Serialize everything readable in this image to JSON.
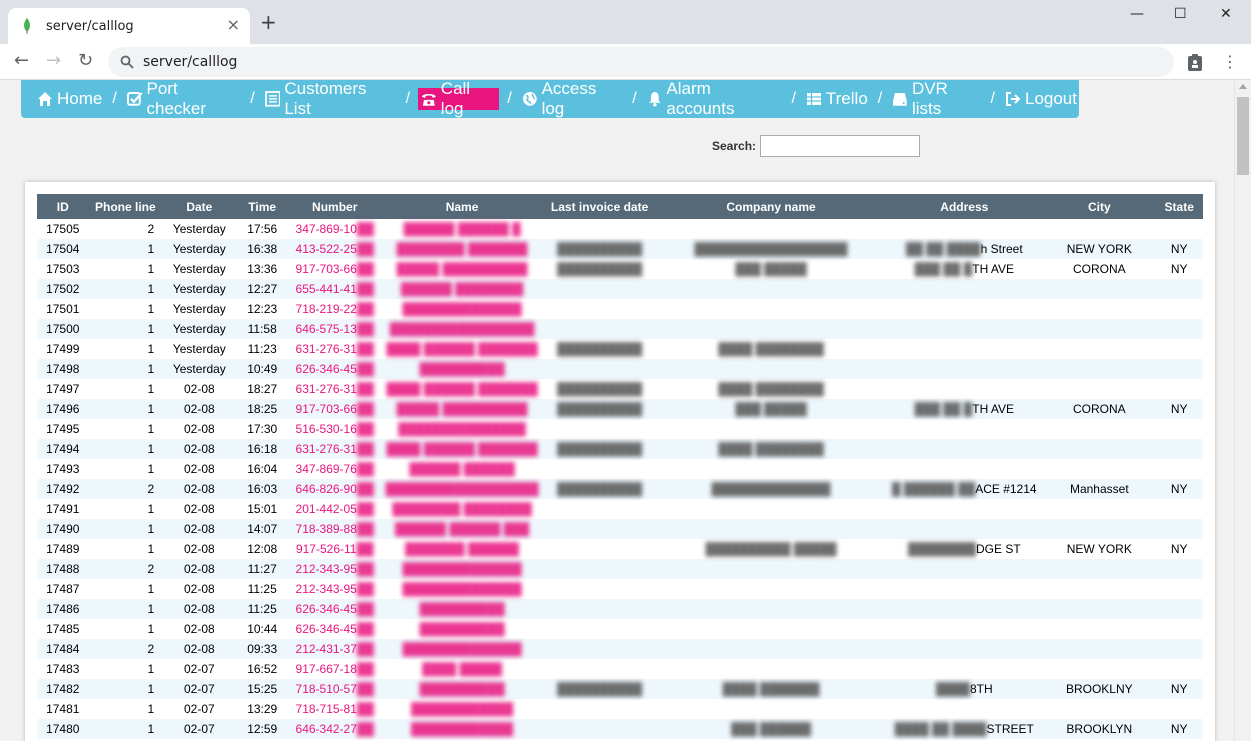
{
  "browser": {
    "tab_title": "server/calllog",
    "url": "server/calllog",
    "new_tab": "+",
    "close_tab": "×",
    "window_minimize": "—",
    "window_maximize": "☐",
    "window_close": "✕"
  },
  "nav": {
    "items": [
      {
        "label": "Home",
        "icon": "home-icon"
      },
      {
        "label": "Port checker",
        "icon": "check-square-icon"
      },
      {
        "label": "Customers List",
        "icon": "list-icon"
      },
      {
        "label": "Call log",
        "icon": "phone-icon",
        "active": true
      },
      {
        "label": "Access log",
        "icon": "globe-icon"
      },
      {
        "label": "Alarm accounts",
        "icon": "bell-icon"
      },
      {
        "label": "Trello",
        "icon": "table-icon"
      },
      {
        "label": "DVR lists",
        "icon": "hdd-icon"
      },
      {
        "label": "Logout",
        "icon": "logout-icon"
      }
    ],
    "separator": "/",
    "active_color": "#e8157f",
    "bar_color": "#5bc0de"
  },
  "search": {
    "label": "Search:",
    "value": ""
  },
  "table": {
    "header_color": "#566978",
    "columns": [
      "ID",
      "Phone line",
      "Date",
      "Time",
      "Number",
      "Name",
      "Last invoice date",
      "Company name",
      "Address",
      "City",
      "State"
    ],
    "rows": [
      {
        "id": "17505",
        "line": "2",
        "date": "Yesterday",
        "time": "17:56",
        "number": "347-869-10",
        "name": "██████ ██████ █",
        "inv": "",
        "comp": "",
        "addr": "",
        "city": "",
        "state": ""
      },
      {
        "id": "17504",
        "line": "1",
        "date": "Yesterday",
        "time": "16:38",
        "number": "413-522-25",
        "name": "████████ ███████",
        "inv": "██████████",
        "comp": "██████████████████",
        "addr": "██ ██ ████h Street",
        "city": "NEW YORK",
        "state": "NY"
      },
      {
        "id": "17503",
        "line": "1",
        "date": "Yesterday",
        "time": "13:36",
        "number": "917-703-66",
        "name": "█████ ██████████",
        "inv": "██████████",
        "comp": "███ █████",
        "addr": "███ ██ █TH AVE",
        "city": "CORONA",
        "state": "NY"
      },
      {
        "id": "17502",
        "line": "1",
        "date": "Yesterday",
        "time": "12:27",
        "number": "655-441-41",
        "name": "██████ ████████",
        "inv": "",
        "comp": "",
        "addr": "",
        "city": "",
        "state": ""
      },
      {
        "id": "17501",
        "line": "1",
        "date": "Yesterday",
        "time": "12:23",
        "number": "718-219-22",
        "name": "██████████████",
        "inv": "",
        "comp": "",
        "addr": "",
        "city": "",
        "state": ""
      },
      {
        "id": "17500",
        "line": "1",
        "date": "Yesterday",
        "time": "11:58",
        "number": "646-575-13",
        "name": "█████████████████",
        "inv": "",
        "comp": "",
        "addr": "",
        "city": "",
        "state": ""
      },
      {
        "id": "17499",
        "line": "1",
        "date": "Yesterday",
        "time": "11:23",
        "number": "631-276-31",
        "name": "████ ██████ ███████",
        "inv": "██████████",
        "comp": "████ ████████",
        "addr": "",
        "city": "",
        "state": ""
      },
      {
        "id": "17498",
        "line": "1",
        "date": "Yesterday",
        "time": "10:49",
        "number": "626-346-45",
        "name": "██████████",
        "inv": "",
        "comp": "",
        "addr": "",
        "city": "",
        "state": ""
      },
      {
        "id": "17497",
        "line": "1",
        "date": "02-08",
        "time": "18:27",
        "number": "631-276-31",
        "name": "████ ██████ ███████",
        "inv": "██████████",
        "comp": "████ ████████",
        "addr": "",
        "city": "",
        "state": ""
      },
      {
        "id": "17496",
        "line": "1",
        "date": "02-08",
        "time": "18:25",
        "number": "917-703-66",
        "name": "█████ ██████████",
        "inv": "██████████",
        "comp": "███ █████",
        "addr": "███ ██ █TH AVE",
        "city": "CORONA",
        "state": "NY"
      },
      {
        "id": "17495",
        "line": "1",
        "date": "02-08",
        "time": "17:30",
        "number": "516-530-16",
        "name": "███████████████",
        "inv": "",
        "comp": "",
        "addr": "",
        "city": "",
        "state": ""
      },
      {
        "id": "17494",
        "line": "1",
        "date": "02-08",
        "time": "16:18",
        "number": "631-276-31",
        "name": "████ ██████ ███████",
        "inv": "██████████",
        "comp": "████ ████████",
        "addr": "",
        "city": "",
        "state": ""
      },
      {
        "id": "17493",
        "line": "1",
        "date": "02-08",
        "time": "16:04",
        "number": "347-869-76",
        "name": "██████ ██████",
        "inv": "",
        "comp": "",
        "addr": "",
        "city": "",
        "state": ""
      },
      {
        "id": "17492",
        "line": "2",
        "date": "02-08",
        "time": "16:03",
        "number": "646-826-90",
        "name": "██████████████████",
        "inv": "██████████",
        "comp": "██████████████",
        "addr": "█ ██████ ██ACE #1214",
        "city": "Manhasset",
        "state": "NY"
      },
      {
        "id": "17491",
        "line": "1",
        "date": "02-08",
        "time": "15:01",
        "number": "201-442-05",
        "name": "████████ ████████",
        "inv": "",
        "comp": "",
        "addr": "",
        "city": "",
        "state": ""
      },
      {
        "id": "17490",
        "line": "1",
        "date": "02-08",
        "time": "14:07",
        "number": "718-389-88",
        "name": "██████ ██████ ███",
        "inv": "",
        "comp": "",
        "addr": "",
        "city": "",
        "state": ""
      },
      {
        "id": "17489",
        "line": "1",
        "date": "02-08",
        "time": "12:08",
        "number": "917-526-11",
        "name": "███████ ██████",
        "inv": "",
        "comp": "██████████ █████",
        "addr": "████████DGE ST",
        "city": "NEW YORK",
        "state": "NY"
      },
      {
        "id": "17488",
        "line": "2",
        "date": "02-08",
        "time": "11:27",
        "number": "212-343-95",
        "name": "██████████████",
        "inv": "",
        "comp": "",
        "addr": "",
        "city": "",
        "state": ""
      },
      {
        "id": "17487",
        "line": "1",
        "date": "02-08",
        "time": "11:25",
        "number": "212-343-95",
        "name": "██████████████",
        "inv": "",
        "comp": "",
        "addr": "",
        "city": "",
        "state": ""
      },
      {
        "id": "17486",
        "line": "1",
        "date": "02-08",
        "time": "11:25",
        "number": "626-346-45",
        "name": "██████████",
        "inv": "",
        "comp": "",
        "addr": "",
        "city": "",
        "state": ""
      },
      {
        "id": "17485",
        "line": "1",
        "date": "02-08",
        "time": "10:44",
        "number": "626-346-45",
        "name": "██████████",
        "inv": "",
        "comp": "",
        "addr": "",
        "city": "",
        "state": ""
      },
      {
        "id": "17484",
        "line": "2",
        "date": "02-08",
        "time": "09:33",
        "number": "212-431-37",
        "name": "██████████████",
        "inv": "",
        "comp": "",
        "addr": "",
        "city": "",
        "state": ""
      },
      {
        "id": "17483",
        "line": "1",
        "date": "02-07",
        "time": "16:52",
        "number": "917-667-18",
        "name": "████ █████",
        "inv": "",
        "comp": "",
        "addr": "",
        "city": "",
        "state": ""
      },
      {
        "id": "17482",
        "line": "1",
        "date": "02-07",
        "time": "15:25",
        "number": "718-510-57",
        "name": "██████████",
        "inv": "██████████",
        "comp": "████ ███████",
        "addr": "████ 8TH",
        "city": "BROOKLNY",
        "state": "NY"
      },
      {
        "id": "17481",
        "line": "1",
        "date": "02-07",
        "time": "13:29",
        "number": "718-715-81",
        "name": "████████████",
        "inv": "",
        "comp": "",
        "addr": "",
        "city": "",
        "state": ""
      },
      {
        "id": "17480",
        "line": "1",
        "date": "02-07",
        "time": "12:59",
        "number": "646-342-27",
        "name": "████████████",
        "inv": "",
        "comp": "███ ██████",
        "addr": "████ ██ ████ STREET",
        "city": "BROOKLYN",
        "state": "NY"
      }
    ]
  }
}
